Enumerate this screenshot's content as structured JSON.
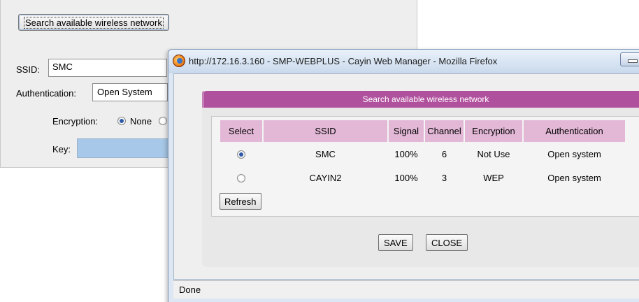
{
  "background_form": {
    "search_button_label": "Search available wireless network",
    "ssid_label": "SSID:",
    "ssid_value": "SMC",
    "auth_label": "Authentication:",
    "auth_value": "Open System",
    "encryption_label": "Encryption:",
    "encryption_none_label": "None",
    "key_label": "Key:"
  },
  "popup": {
    "window_title": "http://172.16.3.160 - SMP-WEBPLUS - Cayin Web Manager - Mozilla Firefox",
    "dialog_title": "Search available wireless network",
    "columns": [
      "Select",
      "SSID",
      "Signal",
      "Channel",
      "Encryption",
      "Authentication"
    ],
    "networks": [
      {
        "selected": true,
        "ssid": "SMC",
        "signal": "100%",
        "channel": "6",
        "encryption": "Not Use",
        "authentication": "Open system"
      },
      {
        "selected": false,
        "ssid": "CAYIN2",
        "signal": "100%",
        "channel": "3",
        "encryption": "WEP",
        "authentication": "Open system"
      }
    ],
    "refresh_label": "Refresh",
    "save_label": "SAVE",
    "close_label": "CLOSE",
    "status_text": "Done"
  },
  "icons": {
    "browser": "firefox-icon",
    "minimize": "minimize-icon"
  },
  "colors": {
    "dialog_header": "#b0519d",
    "table_header": "#e3b8d6",
    "key_field": "#a7c8e8"
  }
}
